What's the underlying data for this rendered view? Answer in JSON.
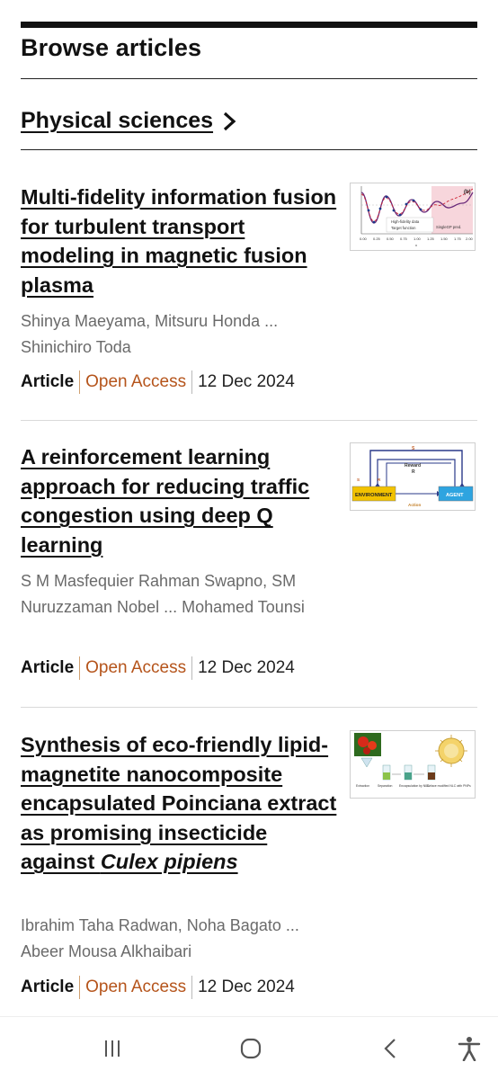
{
  "header": {
    "title": "Browse articles"
  },
  "section": {
    "label": "Physical sciences"
  },
  "articles": [
    {
      "title": "Multi-fidelity information fusion for turbulent transport modeling in magnetic fusion plasma",
      "authors": "Shinya Maeyama, Mitsuru Honda ... Shinichiro Toda",
      "type": "Article",
      "access": "Open Access",
      "date": "12 Dec 2024",
      "thumbnail": {
        "panel_label": "(b)",
        "legend": [
          "High-fidelity data",
          "Target function",
          "SingleGP pred."
        ],
        "x_ticks": [
          "0.00",
          "0.25",
          "0.50",
          "0.75",
          "1.00",
          "1.25",
          "1.50",
          "1.75",
          "2.00"
        ],
        "xlabel": "x"
      }
    },
    {
      "title": "A reinforcement learning approach for reducing traffic congestion using deep Q learning",
      "authors": "S M Masfequier Rahman Swapno, SM Nuruzzaman Nobel ... Mohamed Tounsi",
      "type": "Article",
      "access": "Open Access",
      "date": "12 Dec 2024",
      "thumbnail": {
        "environment": "ENVIRONMENT",
        "agent": "AGENT",
        "reward": "Reward",
        "reward_sym": "R",
        "state_sym": "S",
        "action": "Action"
      }
    },
    {
      "title_parts": [
        "Synthesis of eco-friendly lipid-magnetite nanocomposite encapsulated Poinciana extract as promising insecticide against ",
        "Culex pipiens"
      ],
      "authors": "Ibrahim Taha Radwan, Noha Bagato ... Abeer Mousa Alkhaibari",
      "type": "Article",
      "access": "Open Access",
      "date": "12 Dec 2024",
      "thumbnail": {
        "steps": [
          "Extraction",
          "Separation",
          "Encapsulation by NLC",
          "Surface modified NLC with PNPs"
        ]
      }
    }
  ],
  "colors": {
    "accent": "#b5541b",
    "text": "#111111",
    "muted": "#6a6a6a"
  },
  "navbar": {
    "icons": [
      "recent-apps-icon",
      "home-icon",
      "back-icon",
      "accessibility-icon"
    ]
  }
}
